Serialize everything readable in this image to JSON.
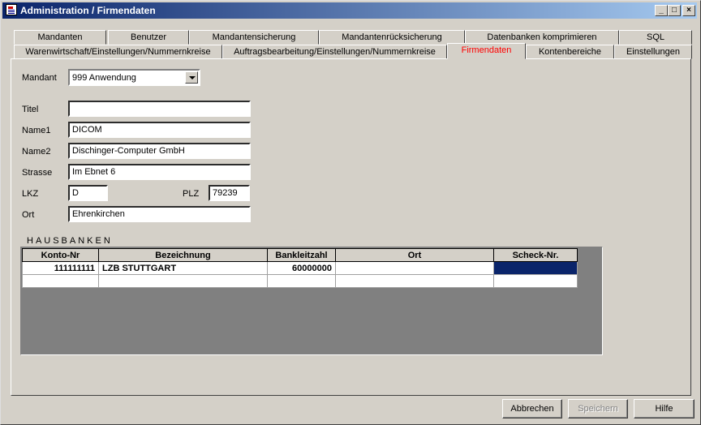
{
  "window": {
    "title": "Administration / Firmendaten"
  },
  "tabs_row1": [
    "Mandanten",
    "Benutzer",
    "Mandantensicherung",
    "Mandantenrücksicherung",
    "Datenbanken komprimieren",
    "SQL"
  ],
  "tabs_row2": [
    "Warenwirtschaft/Einstellungen/Nummernkreise",
    "Auftragsbearbeitung/Einstellungen/Nummernkreise",
    "Firmendaten",
    "Kontenbereiche",
    "Einstellungen"
  ],
  "active_tab": "Firmendaten",
  "form": {
    "mandant_label": "Mandant",
    "mandant_value": "999 Anwendung",
    "titel_label": "Titel",
    "titel_value": "",
    "name1_label": "Name1",
    "name1_value": "DICOM",
    "name2_label": "Name2",
    "name2_value": "Dischinger-Computer GmbH",
    "strasse_label": "Strasse",
    "strasse_value": "Im Ebnet 6",
    "lkz_label": "LKZ",
    "lkz_value": "D",
    "plz_label": "PLZ",
    "plz_value": "79239",
    "ort_label": "Ort",
    "ort_value": "Ehrenkirchen"
  },
  "hausbanken": {
    "title": "HAUSBANKEN",
    "columns": [
      "Konto-Nr",
      "Bezeichnung",
      "Bankleitzahl",
      "Ort",
      "Scheck-Nr."
    ],
    "rows": [
      [
        "111111111",
        "LZB STUTTGART",
        "60000000",
        "",
        ""
      ],
      [
        "",
        "",
        "",
        "",
        ""
      ]
    ]
  },
  "buttons": {
    "cancel": "Abbrechen",
    "save": "Speichern",
    "help": "Hilfe"
  },
  "colors": {
    "titlebar": "#0a246a",
    "active_tab_text": "#ff0000",
    "selection": "#0a246a"
  }
}
